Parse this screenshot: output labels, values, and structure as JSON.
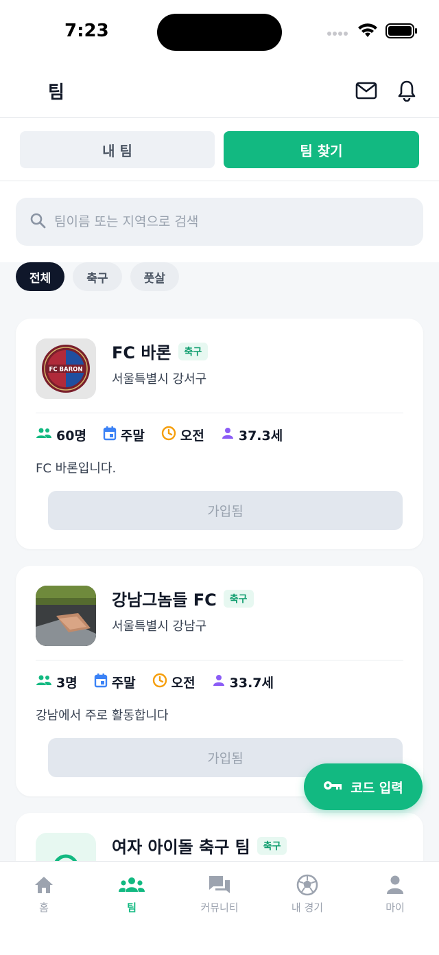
{
  "status_bar": {
    "time": "7:23"
  },
  "header": {
    "title": "팀"
  },
  "segments": [
    {
      "label": "내 팀",
      "active": false
    },
    {
      "label": "팀 찾기",
      "active": true
    }
  ],
  "search": {
    "placeholder": "팀이름 또는 지역으로 검색",
    "value": ""
  },
  "filters": [
    {
      "label": "전체",
      "active": true
    },
    {
      "label": "축구",
      "active": false
    },
    {
      "label": "풋살",
      "active": false
    }
  ],
  "teams": [
    {
      "name": "FC 바론",
      "logo_text": "FC BARON",
      "sport": "축구",
      "location": "서울특별시 강서구",
      "members": "60명",
      "days": "주말",
      "time": "오전",
      "avg_age": "37.3세",
      "description": "FC 바론입니다.",
      "join_label": "가입됨"
    },
    {
      "name": "강남그놈들 FC",
      "sport": "축구",
      "location": "서울특별시 강남구",
      "members": "3명",
      "days": "주말",
      "time": "오전",
      "avg_age": "33.7세",
      "description": "강남에서 주로 활동합니다",
      "join_label": "가입됨"
    },
    {
      "name": "여자 아이돌 축구 팀",
      "sport": "축구"
    }
  ],
  "fab": {
    "label": "코드 입력"
  },
  "tabbar": [
    {
      "label": "홈",
      "icon": "home-icon",
      "active": false
    },
    {
      "label": "팀",
      "icon": "team-icon",
      "active": true
    },
    {
      "label": "커뮤니티",
      "icon": "chat-icon",
      "active": false
    },
    {
      "label": "내 경기",
      "icon": "soccer-ball-icon",
      "active": false
    },
    {
      "label": "마이",
      "icon": "person-icon",
      "active": false
    }
  ],
  "colors": {
    "accent": "#12b981",
    "dark_chip": "#0f172a",
    "member_icon": "#12b981",
    "calendar_icon": "#3b82f6",
    "clock_icon": "#f59e0b",
    "age_icon": "#8b5cf6"
  }
}
